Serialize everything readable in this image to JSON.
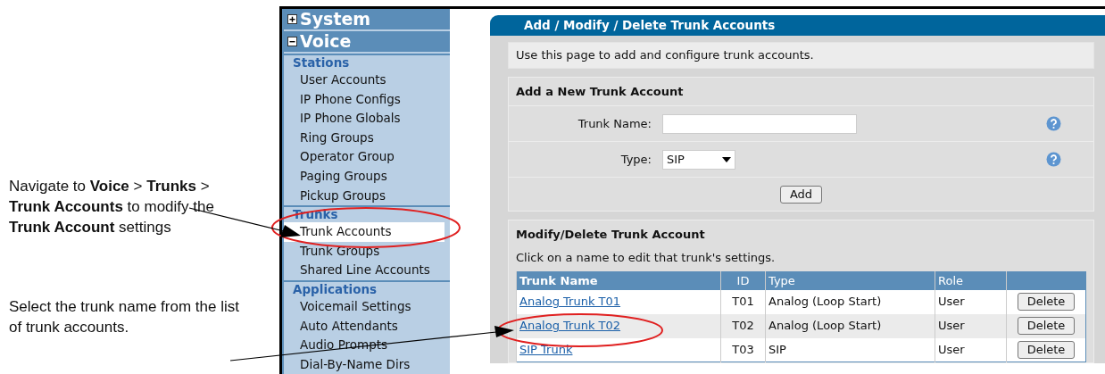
{
  "callouts": [
    {
      "text": "Navigate to **Voice** > **Trunks** > **Trunk Accounts** to modify the **Trunk Account** settings"
    },
    {
      "text": "Select the trunk name from the list of trunk accounts."
    }
  ],
  "sidebar": {
    "menus": [
      {
        "label": "System",
        "expanded": false
      },
      {
        "label": "Voice",
        "expanded": true,
        "sections": [
          {
            "label": "Stations",
            "items": [
              {
                "label": "User Accounts",
                "selected": false
              },
              {
                "label": "IP Phone Configs",
                "selected": false
              },
              {
                "label": "IP Phone Globals",
                "selected": false
              },
              {
                "label": "Ring Groups",
                "selected": false
              },
              {
                "label": "Operator Group",
                "selected": false
              },
              {
                "label": "Paging Groups",
                "selected": false
              },
              {
                "label": "Pickup Groups",
                "selected": false
              }
            ]
          },
          {
            "label": "Trunks",
            "items": [
              {
                "label": "Trunk Accounts",
                "selected": true
              },
              {
                "label": "Trunk Groups",
                "selected": false
              },
              {
                "label": "Shared Line Accounts",
                "selected": false
              }
            ]
          },
          {
            "label": "Applications",
            "items": [
              {
                "label": "Voicemail Settings",
                "selected": false
              },
              {
                "label": "Auto Attendants",
                "selected": false
              },
              {
                "label": "Audio Prompts",
                "selected": false
              },
              {
                "label": "Dial-By-Name Dirs",
                "selected": false
              }
            ]
          }
        ]
      }
    ]
  },
  "page": {
    "title": "Add / Modify / Delete Trunk Accounts",
    "intro": "Use this page to add and configure trunk accounts.",
    "add_section": {
      "title": "Add a New Trunk Account",
      "fields": [
        {
          "label": "Trunk Name:",
          "kind": "text"
        },
        {
          "label": "Type:",
          "kind": "select",
          "value": "SIP"
        }
      ],
      "button": "Add"
    },
    "modify_section": {
      "title": "Modify/Delete Trunk Account",
      "hint": "Click on a name to edit that trunk's settings.",
      "columns": [
        "Trunk Name",
        "ID",
        "Type",
        "Role"
      ],
      "rows": [
        {
          "name": "Analog Trunk T01",
          "id": "T01",
          "type": "Analog (Loop Start)",
          "role": "User",
          "action": "Delete"
        },
        {
          "name": "Analog Trunk T02",
          "id": "T02",
          "type": "Analog (Loop Start)",
          "role": "User",
          "action": "Delete"
        },
        {
          "name": "SIP Trunk",
          "id": "T03",
          "type": "SIP",
          "role": "User",
          "action": "Delete"
        }
      ]
    }
  }
}
